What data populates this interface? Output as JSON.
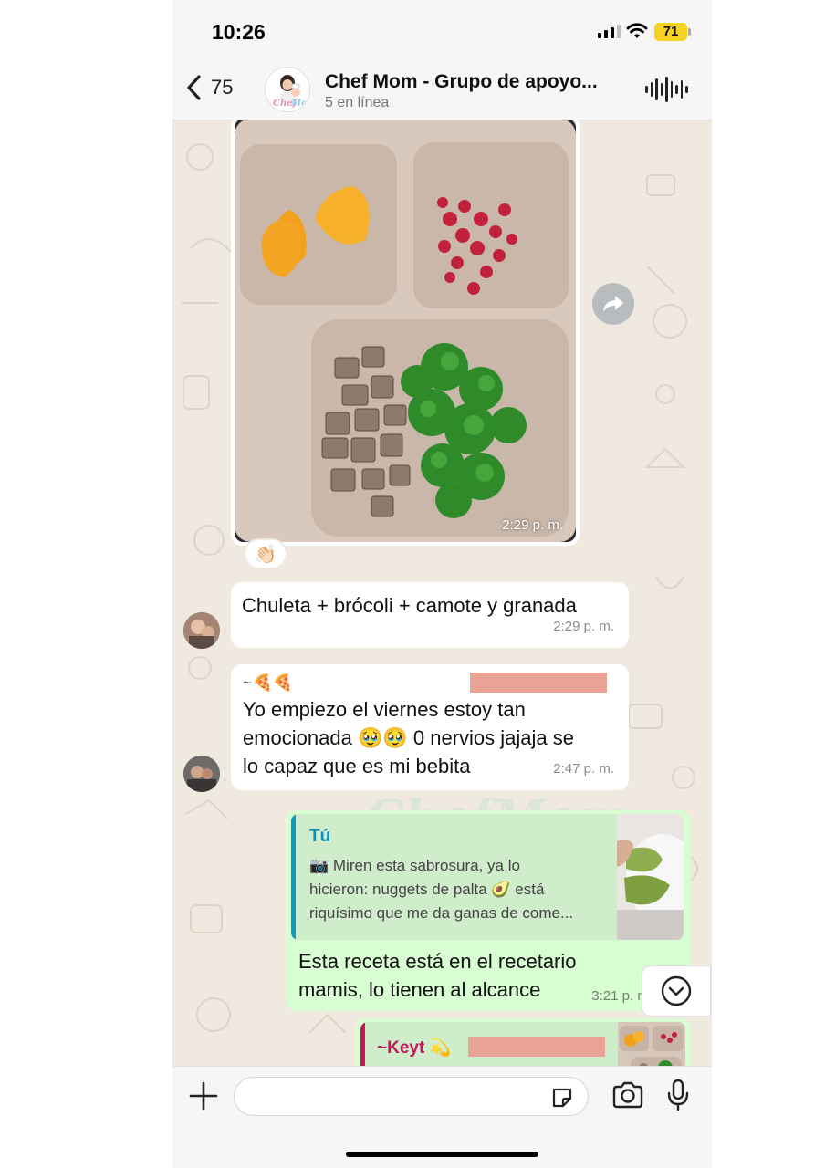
{
  "status_bar": {
    "time": "10:26",
    "battery": "71"
  },
  "header": {
    "back_count": "75",
    "group_name": "Chef Mom - Grupo de apoyo...",
    "subtitle": "5 en línea"
  },
  "messages": [
    {
      "type": "image",
      "time": "2:29 p. m.",
      "reaction": "👏🏻"
    },
    {
      "type": "text",
      "text": "Chuleta + brócoli + camote y granada",
      "time": "2:29 p. m."
    },
    {
      "type": "text",
      "sender": "~🍕🍕",
      "lines": [
        "Yo empiezo el viernes estoy tan",
        "emocionada 🥹🥹 0 nervios jajaja se",
        "lo capaz que es mi bebita"
      ],
      "time": "2:47 p. m."
    },
    {
      "type": "reply_outgoing",
      "quote_author": "Tú",
      "quote_lines": [
        "📷 Miren esta sabrosura, ya lo",
        "hicieron: nuggets de palta 🥑  está",
        "riquísimo que me da ganas de come..."
      ],
      "lines": [
        "Esta receta está en el recetario",
        "mamis, lo tienen al alcance"
      ],
      "time": "3:21 p. m."
    },
    {
      "type": "reply_outgoing_partial",
      "quote_author": "~Keyt 💫"
    }
  ],
  "watermark": "ChefMom",
  "icons": {
    "back": "chevron-left-icon",
    "audio": "waveform-icon",
    "forward": "forward-icon",
    "scroll": "chevron-down-icon",
    "attach": "plus-icon",
    "sticker": "sticker-icon",
    "camera": "camera-icon",
    "mic": "microphone-icon"
  },
  "colors": {
    "outgoing_bubble": "#d9fdd3",
    "incoming_bubble": "#ffffff",
    "quote_self": "#0b9bc3",
    "quote_other": "#c2185b",
    "chat_bg": "#efe9df"
  }
}
